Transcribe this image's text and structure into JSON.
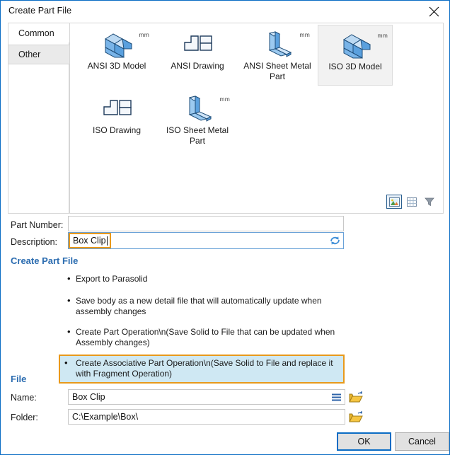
{
  "window": {
    "title": "Create Part File",
    "close_icon": "close-icon"
  },
  "tabs": [
    {
      "label": "Common",
      "selected": true
    },
    {
      "label": "Other",
      "selected": false
    }
  ],
  "gallery": {
    "unit_badge": "mm",
    "tiles": [
      {
        "label": "ANSI 3D Model",
        "icon": "iso-block-icon",
        "unit": "mm",
        "selected": false
      },
      {
        "label": "ANSI Drawing",
        "icon": "drawing-sheet-icon",
        "unit": "",
        "selected": false
      },
      {
        "label": "ANSI Sheet Metal Part",
        "icon": "sheet-metal-icon",
        "unit": "mm",
        "selected": false
      },
      {
        "label": "ISO 3D Model",
        "icon": "iso-block-icon",
        "unit": "mm",
        "selected": true
      },
      {
        "label": "ISO Drawing",
        "icon": "drawing-sheet-icon",
        "unit": "",
        "selected": false
      },
      {
        "label": "ISO Sheet Metal Part",
        "icon": "sheet-metal-icon",
        "unit": "mm",
        "selected": false
      }
    ],
    "view_modes": [
      {
        "name": "thumbnail-view-icon",
        "active": true
      },
      {
        "name": "grid-view-icon",
        "active": false
      },
      {
        "name": "filter-icon",
        "active": false
      }
    ]
  },
  "form": {
    "part_number_label": "Part Number:",
    "part_number_value": "",
    "description_label": "Description:",
    "description_value": "Box Clip",
    "refresh_icon": "refresh-icon"
  },
  "create_part_file": {
    "heading": "Create Part File",
    "options": [
      {
        "text": "Export to Parasolid",
        "selected": false
      },
      {
        "text": "Save body as a new detail file that will automatically update when assembly changes",
        "selected": false
      },
      {
        "text": "Create Part Operation\\n(Save Solid to File that can be  updated when Assembly changes)",
        "selected": false
      },
      {
        "text": "Create Associative Part Operation\\n(Save Solid to File and replace it with Fragment Operation)",
        "selected": true
      }
    ]
  },
  "file": {
    "heading": "File",
    "name_label": "Name:",
    "name_value": "Box Clip",
    "name_menu_icon": "hamburger-menu-icon",
    "name_browse_icon": "folder-open-icon",
    "folder_label": "Folder:",
    "folder_value": "C:\\Example\\Box\\",
    "folder_browse_icon": "folder-open-icon"
  },
  "footer": {
    "ok_label": "OK",
    "cancel_label": "Cancel"
  },
  "colors": {
    "accent": "#0a6cc4",
    "heading": "#2b6cb0",
    "highlight": "#e8991c",
    "selection": "#cfe8f3"
  }
}
